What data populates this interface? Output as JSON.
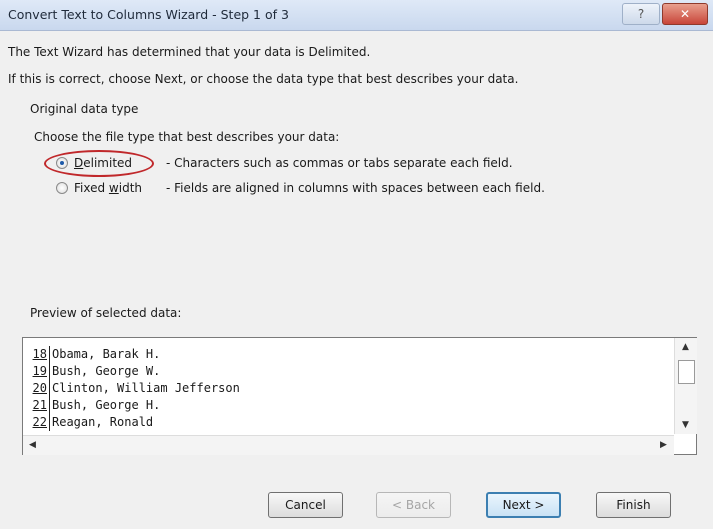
{
  "window": {
    "title": "Convert Text to Columns Wizard - Step 1 of 3",
    "help_label": "?",
    "close_label": "✕"
  },
  "intro": {
    "line1": "The Text Wizard has determined that your data is Delimited.",
    "line2": "If this is correct, choose Next, or choose the data type that best describes your data."
  },
  "data_type": {
    "group_label": "Original data type",
    "prompt": "Choose the file type that best describes your data:",
    "options": [
      {
        "label_pre": "",
        "label_key": "D",
        "label_post": "elimited",
        "description": "- Characters such as commas or tabs separate each field.",
        "selected": true
      },
      {
        "label_pre": "Fixed ",
        "label_key": "w",
        "label_post": "idth",
        "description": "- Fields are aligned in columns with spaces between each field.",
        "selected": false
      }
    ]
  },
  "preview": {
    "label": "Preview of selected data:",
    "rows": [
      {
        "num": "18",
        "text": "Obama, Barak H."
      },
      {
        "num": "19",
        "text": "Bush, George W."
      },
      {
        "num": "20",
        "text": "Clinton, William Jefferson"
      },
      {
        "num": "21",
        "text": "Bush, George H."
      },
      {
        "num": "22",
        "text": "Reagan, Ronald"
      }
    ]
  },
  "buttons": {
    "cancel": "Cancel",
    "back": "< Back",
    "next": "Next >",
    "finish": "Finish"
  },
  "colors": {
    "highlight": "#c0282b",
    "radio_selected": "#1e5aa8",
    "default_button_border": "#3c7fb1"
  }
}
